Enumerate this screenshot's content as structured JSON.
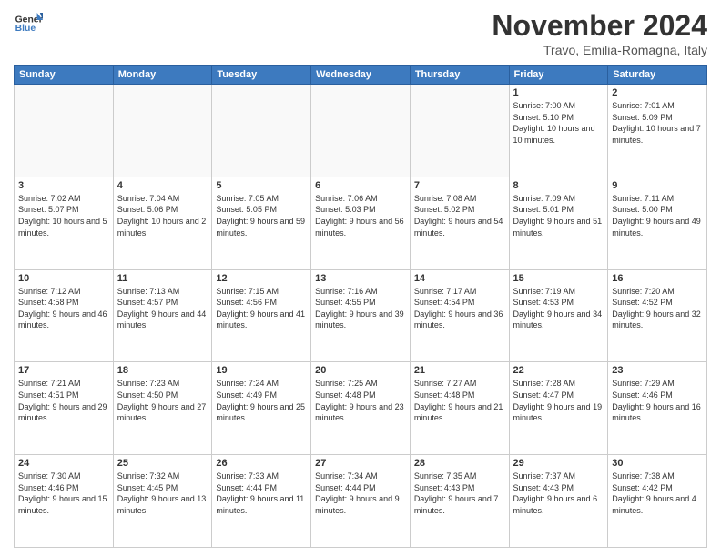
{
  "header": {
    "logo_text_general": "General",
    "logo_text_blue": "Blue",
    "month": "November 2024",
    "location": "Travo, Emilia-Romagna, Italy"
  },
  "weekdays": [
    "Sunday",
    "Monday",
    "Tuesday",
    "Wednesday",
    "Thursday",
    "Friday",
    "Saturday"
  ],
  "weeks": [
    [
      {
        "day": "",
        "empty": true
      },
      {
        "day": "",
        "empty": true
      },
      {
        "day": "",
        "empty": true
      },
      {
        "day": "",
        "empty": true
      },
      {
        "day": "",
        "empty": true
      },
      {
        "day": "1",
        "info": "Sunrise: 7:00 AM\nSunset: 5:10 PM\nDaylight: 10 hours\nand 10 minutes."
      },
      {
        "day": "2",
        "info": "Sunrise: 7:01 AM\nSunset: 5:09 PM\nDaylight: 10 hours\nand 7 minutes."
      }
    ],
    [
      {
        "day": "3",
        "info": "Sunrise: 7:02 AM\nSunset: 5:07 PM\nDaylight: 10 hours\nand 5 minutes."
      },
      {
        "day": "4",
        "info": "Sunrise: 7:04 AM\nSunset: 5:06 PM\nDaylight: 10 hours\nand 2 minutes."
      },
      {
        "day": "5",
        "info": "Sunrise: 7:05 AM\nSunset: 5:05 PM\nDaylight: 9 hours\nand 59 minutes."
      },
      {
        "day": "6",
        "info": "Sunrise: 7:06 AM\nSunset: 5:03 PM\nDaylight: 9 hours\nand 56 minutes."
      },
      {
        "day": "7",
        "info": "Sunrise: 7:08 AM\nSunset: 5:02 PM\nDaylight: 9 hours\nand 54 minutes."
      },
      {
        "day": "8",
        "info": "Sunrise: 7:09 AM\nSunset: 5:01 PM\nDaylight: 9 hours\nand 51 minutes."
      },
      {
        "day": "9",
        "info": "Sunrise: 7:11 AM\nSunset: 5:00 PM\nDaylight: 9 hours\nand 49 minutes."
      }
    ],
    [
      {
        "day": "10",
        "info": "Sunrise: 7:12 AM\nSunset: 4:58 PM\nDaylight: 9 hours\nand 46 minutes."
      },
      {
        "day": "11",
        "info": "Sunrise: 7:13 AM\nSunset: 4:57 PM\nDaylight: 9 hours\nand 44 minutes."
      },
      {
        "day": "12",
        "info": "Sunrise: 7:15 AM\nSunset: 4:56 PM\nDaylight: 9 hours\nand 41 minutes."
      },
      {
        "day": "13",
        "info": "Sunrise: 7:16 AM\nSunset: 4:55 PM\nDaylight: 9 hours\nand 39 minutes."
      },
      {
        "day": "14",
        "info": "Sunrise: 7:17 AM\nSunset: 4:54 PM\nDaylight: 9 hours\nand 36 minutes."
      },
      {
        "day": "15",
        "info": "Sunrise: 7:19 AM\nSunset: 4:53 PM\nDaylight: 9 hours\nand 34 minutes."
      },
      {
        "day": "16",
        "info": "Sunrise: 7:20 AM\nSunset: 4:52 PM\nDaylight: 9 hours\nand 32 minutes."
      }
    ],
    [
      {
        "day": "17",
        "info": "Sunrise: 7:21 AM\nSunset: 4:51 PM\nDaylight: 9 hours\nand 29 minutes."
      },
      {
        "day": "18",
        "info": "Sunrise: 7:23 AM\nSunset: 4:50 PM\nDaylight: 9 hours\nand 27 minutes."
      },
      {
        "day": "19",
        "info": "Sunrise: 7:24 AM\nSunset: 4:49 PM\nDaylight: 9 hours\nand 25 minutes."
      },
      {
        "day": "20",
        "info": "Sunrise: 7:25 AM\nSunset: 4:48 PM\nDaylight: 9 hours\nand 23 minutes."
      },
      {
        "day": "21",
        "info": "Sunrise: 7:27 AM\nSunset: 4:48 PM\nDaylight: 9 hours\nand 21 minutes."
      },
      {
        "day": "22",
        "info": "Sunrise: 7:28 AM\nSunset: 4:47 PM\nDaylight: 9 hours\nand 19 minutes."
      },
      {
        "day": "23",
        "info": "Sunrise: 7:29 AM\nSunset: 4:46 PM\nDaylight: 9 hours\nand 16 minutes."
      }
    ],
    [
      {
        "day": "24",
        "info": "Sunrise: 7:30 AM\nSunset: 4:46 PM\nDaylight: 9 hours\nand 15 minutes."
      },
      {
        "day": "25",
        "info": "Sunrise: 7:32 AM\nSunset: 4:45 PM\nDaylight: 9 hours\nand 13 minutes."
      },
      {
        "day": "26",
        "info": "Sunrise: 7:33 AM\nSunset: 4:44 PM\nDaylight: 9 hours\nand 11 minutes."
      },
      {
        "day": "27",
        "info": "Sunrise: 7:34 AM\nSunset: 4:44 PM\nDaylight: 9 hours\nand 9 minutes."
      },
      {
        "day": "28",
        "info": "Sunrise: 7:35 AM\nSunset: 4:43 PM\nDaylight: 9 hours\nand 7 minutes."
      },
      {
        "day": "29",
        "info": "Sunrise: 7:37 AM\nSunset: 4:43 PM\nDaylight: 9 hours\nand 6 minutes."
      },
      {
        "day": "30",
        "info": "Sunrise: 7:38 AM\nSunset: 4:42 PM\nDaylight: 9 hours\nand 4 minutes."
      }
    ]
  ]
}
